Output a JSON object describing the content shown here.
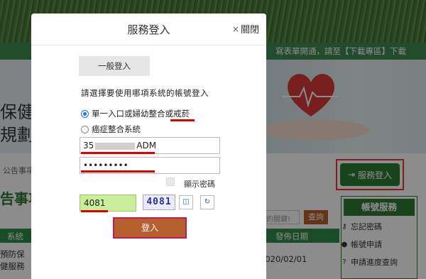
{
  "background": {
    "topbar_text": "寫表單開通，請至【下載專區】下載",
    "banner_title_1": "保健",
    "banner_title_2": "規劃",
    "breadcrumb": "公告事項",
    "section_heading": "告事項",
    "search_placeholder": "的關鍵!",
    "search_button": "查詢",
    "table_header_category": "系統",
    "table_header_date": "發佈日期",
    "row_category": "預防保健服務",
    "row_date": "2020/02/01",
    "service_login_button": "服務登入",
    "account_services": {
      "title": "帳號服務",
      "items": [
        "忘記密碼",
        "帳號申請",
        "申請進度查詢"
      ]
    }
  },
  "modal": {
    "title": "服務登入",
    "close_label": "關閉",
    "general_login": "一般登入",
    "prompt": "請選擇要使用哪項系統的帳號登入",
    "radio_options": [
      {
        "label": "單一入口或婦幼整合或戒菸",
        "checked": true
      },
      {
        "label": "癌症整合系統",
        "checked": false
      }
    ],
    "username_prefix": "35",
    "username_suffix": "ADM",
    "password_value": "•••••••••",
    "show_password_label": "顯示密碼",
    "captcha_value": "4081",
    "captcha_image_text": "4081",
    "login_button": "登入"
  },
  "colors": {
    "accent_green": "#2e7d32",
    "login_brown": "#b5602d",
    "highlight_red": "#e00000",
    "captcha_bg": "#c9ef9b"
  }
}
